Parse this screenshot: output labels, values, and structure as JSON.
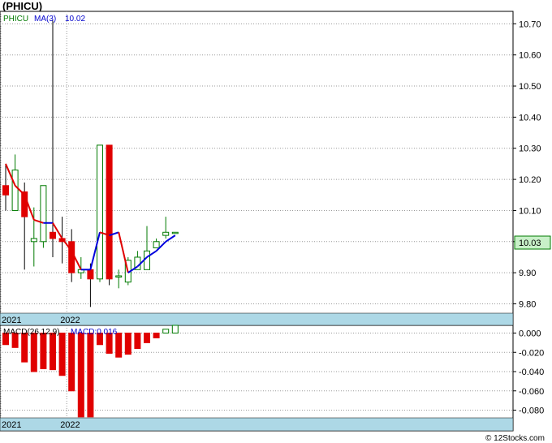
{
  "title": "(PHICU)",
  "legend": {
    "symbol": "PHICU",
    "ma_label": "MA(3)",
    "ma_value": "10.02",
    "macd_label": "MACD(26,12,9)",
    "macd_value": "MACD:0.016"
  },
  "last_price_label": "10.03",
  "footer": "© 12Stocks.com",
  "date_labels": [
    {
      "label": "2021",
      "index": 0
    },
    {
      "label": "2022",
      "index": 7
    }
  ],
  "colors": {
    "up": "#007a00",
    "down": "#e00000",
    "ma_up": "#0000dd",
    "ma_down": "#e00000",
    "date_band": "#add8e6",
    "last_box": "#c8f0c8"
  },
  "chart_data": [
    {
      "type": "candlestick",
      "name": "price",
      "ylim": [
        9.77,
        10.74
      ],
      "yticks": [
        9.8,
        9.9,
        10.0,
        10.1,
        10.2,
        10.3,
        10.4,
        10.5,
        10.6,
        10.7
      ],
      "grid": true,
      "candles": [
        {
          "o": 10.18,
          "h": 10.25,
          "l": 10.1,
          "c": 10.15
        },
        {
          "o": 10.1,
          "h": 10.28,
          "l": 10.1,
          "c": 10.23
        },
        {
          "o": 10.16,
          "h": 10.19,
          "l": 9.91,
          "c": 10.08
        },
        {
          "o": 10.0,
          "h": 10.11,
          "l": 9.92,
          "c": 10.01
        },
        {
          "o": 10.0,
          "h": 10.18,
          "l": 9.98,
          "c": 10.18
        },
        {
          "o": 10.03,
          "h": 10.71,
          "l": 9.95,
          "c": 10.01
        },
        {
          "o": 10.01,
          "h": 10.08,
          "l": 9.93,
          "c": 10.0
        },
        {
          "o": 10.0,
          "h": 10.04,
          "l": 9.87,
          "c": 9.9
        },
        {
          "o": 9.9,
          "h": 9.95,
          "l": 9.88,
          "c": 9.91
        },
        {
          "o": 9.91,
          "h": 9.93,
          "l": 9.79,
          "c": 9.88
        },
        {
          "o": 9.88,
          "h": 10.31,
          "l": 9.87,
          "c": 10.31
        },
        {
          "o": 10.31,
          "h": 10.31,
          "l": 9.86,
          "c": 9.88
        },
        {
          "o": 9.89,
          "h": 9.91,
          "l": 9.85,
          "c": 9.89
        },
        {
          "o": 9.87,
          "h": 9.95,
          "l": 9.86,
          "c": 9.94
        },
        {
          "o": 9.91,
          "h": 9.97,
          "l": 9.91,
          "c": 9.95
        },
        {
          "o": 9.91,
          "h": 10.05,
          "l": 9.91,
          "c": 9.97
        },
        {
          "o": 9.98,
          "h": 10.01,
          "l": 9.98,
          "c": 10.0
        },
        {
          "o": 10.02,
          "h": 10.08,
          "l": 10.01,
          "c": 10.03
        },
        {
          "o": 10.03,
          "h": 10.03,
          "l": 10.03,
          "c": 10.03
        }
      ],
      "ma": {
        "name": "MA(3)",
        "start_index": 0,
        "values": [
          10.25,
          10.18,
          10.15,
          10.07,
          10.06,
          10.06,
          10.01,
          9.97,
          9.91,
          9.91,
          10.03,
          10.02,
          10.03,
          9.9,
          9.92,
          9.95,
          9.97,
          10.0,
          10.02
        ]
      }
    },
    {
      "type": "bar",
      "name": "macd",
      "ylim": [
        -0.088,
        0.008
      ],
      "yticks": [
        0.0,
        -0.02,
        -0.04,
        -0.06,
        -0.08
      ],
      "grid": true,
      "values": [
        -0.012,
        -0.015,
        -0.03,
        -0.04,
        -0.037,
        -0.038,
        -0.044,
        -0.06,
        -0.087,
        -0.087,
        -0.012,
        -0.021,
        -0.025,
        -0.022,
        -0.016,
        -0.01,
        -0.005,
        0.004,
        0.008
      ]
    }
  ]
}
